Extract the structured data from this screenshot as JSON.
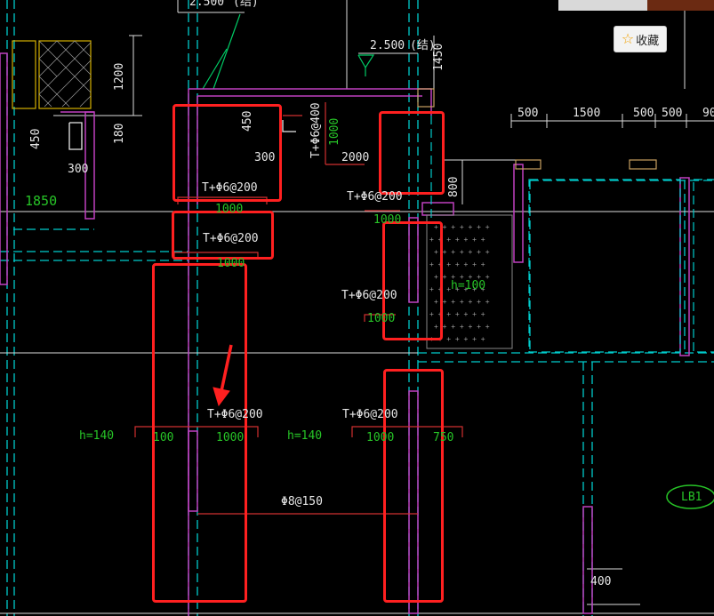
{
  "toolbar": {
    "bookmark_label": "收藏",
    "bookmark_icon": "star-icon"
  },
  "colors": {
    "background": "#000000",
    "highlight_box": "#ff2020",
    "arrow": "#ff2020",
    "dimension_text": "#e6e6e6",
    "green_text": "#27c427",
    "wall": "#c040c0",
    "grid": "#00e5e5"
  },
  "top_labels": {
    "elev_top": "2.500",
    "struct_top": "(结)",
    "elev_mid": "2.500",
    "struct_mid": "(结)"
  },
  "dimensions": {
    "d1200": "1200",
    "d180": "180",
    "d450_left": "450",
    "d300_left": "300",
    "d1850": "1850",
    "d1450": "1450",
    "d450_mid": "450",
    "d300_mid": "300",
    "d2000": "2000",
    "d800": "800",
    "r500a": "500",
    "r1500": "1500",
    "r500b": "500",
    "r500c": "500",
    "r90": "90",
    "d400": "400"
  },
  "rebar_labels": {
    "slab1": "T+Φ6@200",
    "slab2": "T+Φ6@200",
    "slab_right_top": "T+Φ6@200",
    "vert_top": "T+Φ6@400",
    "mid_right": "T+Φ6@200",
    "bottom_left": "T+Φ6@200",
    "bottom_right": "T+Φ6@200",
    "bottom_bar": "Φ8@150"
  },
  "green_labels": {
    "g1000_a": "1000",
    "g1000_b": "1000",
    "g1000_c": "1000",
    "g1000_vert": "1000",
    "g1000_right": "1000",
    "g1000_mid": "1000",
    "h140_left": "h=140",
    "h140_mid": "h=140",
    "g100": "100",
    "g1000_bot": "1000",
    "g1000_bot2": "1000",
    "g750": "750",
    "h100": "h=100"
  },
  "beam_tag": "LB1"
}
